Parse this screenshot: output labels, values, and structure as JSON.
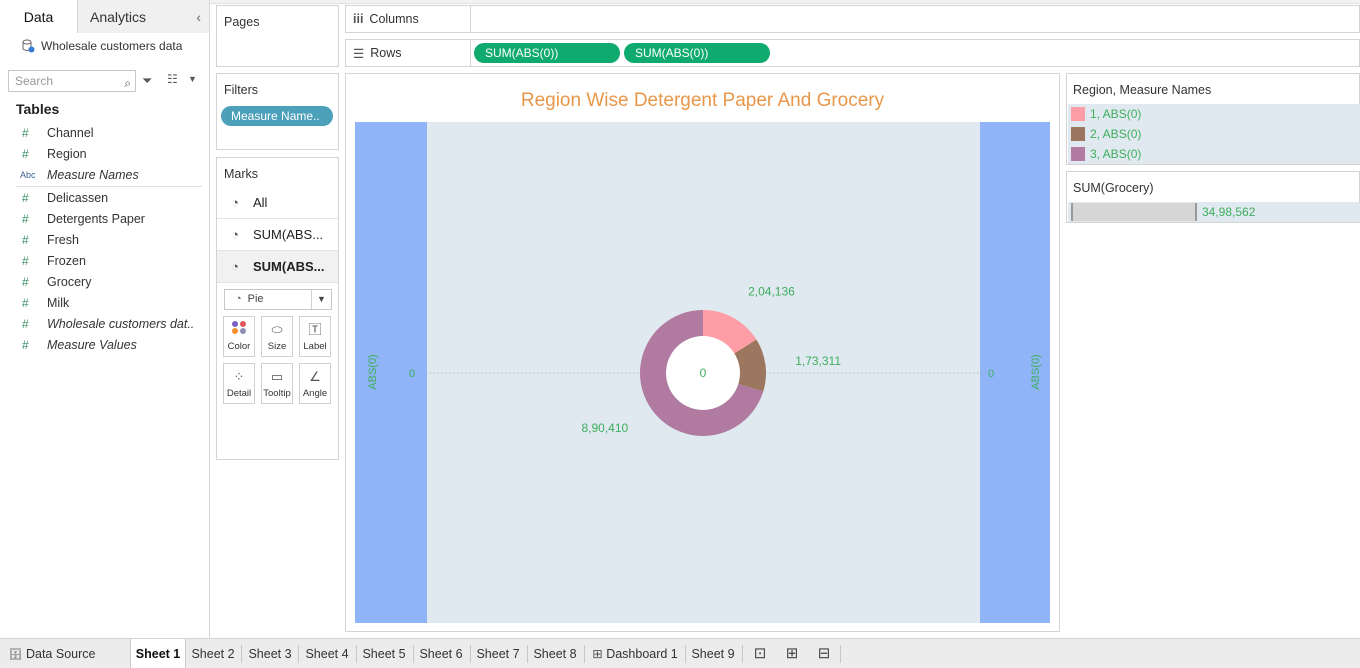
{
  "left_pane": {
    "tab_data": "Data",
    "tab_analytics": "Analytics",
    "datasource": "Wholesale customers data",
    "search_placeholder": "Search",
    "tables_heading": "Tables",
    "fields": [
      {
        "icon": "#",
        "label": "Channel",
        "italic": false
      },
      {
        "icon": "#",
        "label": "Region",
        "italic": false
      },
      {
        "icon": "Abc",
        "label": "Measure Names",
        "italic": true
      },
      {
        "icon": "#",
        "label": "Delicassen",
        "italic": false
      },
      {
        "icon": "#",
        "label": "Detergents Paper",
        "italic": false
      },
      {
        "icon": "#",
        "label": "Fresh",
        "italic": false
      },
      {
        "icon": "#",
        "label": "Frozen",
        "italic": false
      },
      {
        "icon": "#",
        "label": "Grocery",
        "italic": false
      },
      {
        "icon": "#",
        "label": "Milk",
        "italic": false
      },
      {
        "icon": "#",
        "label": "Wholesale customers dat..",
        "italic": true
      },
      {
        "icon": "#",
        "label": "Measure Values",
        "italic": true
      }
    ]
  },
  "pages_title": "Pages",
  "filters": {
    "title": "Filters",
    "pill": "Measure Name.."
  },
  "marks": {
    "title": "Marks",
    "rows": [
      "All",
      "SUM(ABS...",
      "SUM(ABS..."
    ],
    "mark_type": "Pie",
    "buttons": [
      "Color",
      "Size",
      "Label",
      "Detail",
      "Tooltip",
      "Angle"
    ]
  },
  "shelves": {
    "columns_label": "Columns",
    "rows_label": "Rows",
    "row_pills": [
      "SUM(ABS(0))",
      "SUM(ABS(0))"
    ]
  },
  "view": {
    "title": "Region Wise Detergent Paper And Grocery",
    "left_axis": "ABS(0)",
    "right_axis": "ABS(0)",
    "left_tick": "0",
    "right_tick": "0",
    "center_label": "0",
    "colors": {
      "band": "#8fb5f8",
      "plot_bg": "#dfe9ef",
      "title": "#e8974a",
      "labels": "#3fae5e"
    }
  },
  "chart_data": {
    "type": "pie",
    "title": "Region Wise Detergent Paper And Grocery",
    "donut": true,
    "slices": [
      {
        "label": "1, ABS(0)",
        "value": 204136,
        "display": "2,04,136",
        "color": "#ff9da6"
      },
      {
        "label": "2, ABS(0)",
        "value": 173311,
        "display": "1,73,311",
        "color": "#9d7660"
      },
      {
        "label": "3, ABS(0)",
        "value": 890410,
        "display": "8,90,410",
        "color": "#b07aa1"
      }
    ],
    "center_value": "0"
  },
  "legend_color": {
    "title": "Region, Measure Names",
    "items": [
      {
        "label": "1, ABS(0)",
        "color": "#ff9da6"
      },
      {
        "label": "2, ABS(0)",
        "color": "#9d7660"
      },
      {
        "label": "3, ABS(0)",
        "color": "#b07aa1"
      }
    ]
  },
  "legend_size": {
    "title": "SUM(Grocery)",
    "value": "34,98,562"
  },
  "bottom_tabs": {
    "data_source": "Data Source",
    "sheets": [
      "Sheet 1",
      "Sheet 2",
      "Sheet 3",
      "Sheet 4",
      "Sheet 5",
      "Sheet 6",
      "Sheet 7",
      "Sheet 8",
      "Dashboard 1",
      "Sheet 9"
    ],
    "active": "Sheet 1"
  }
}
